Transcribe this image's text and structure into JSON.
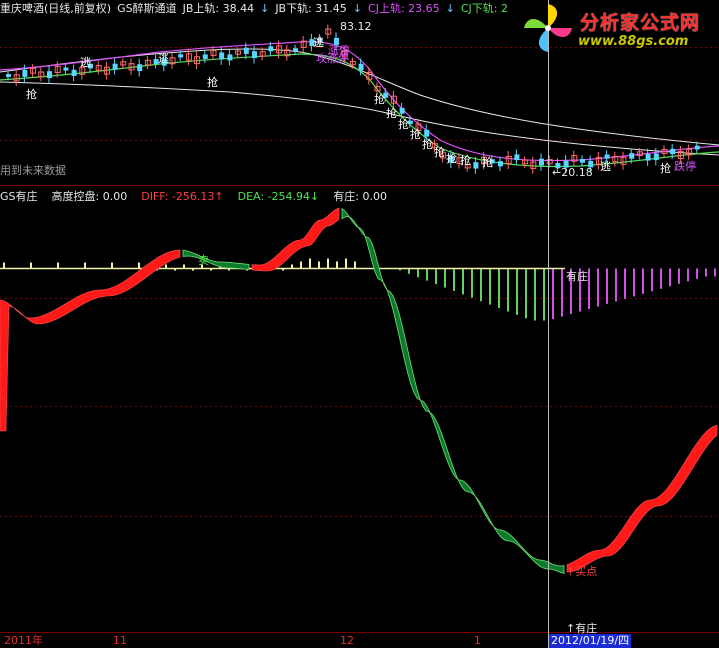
{
  "main_panel": {
    "title_items": [
      {
        "text": "重庆啤酒(日线,前复权)",
        "color": "white"
      },
      {
        "text": "GS醉斯通道",
        "color": "white"
      },
      {
        "text": "JB上轨: 38.44",
        "color": "white"
      },
      {
        "text": "↓",
        "color": "cyan"
      },
      {
        "text": "JB下轨: 31.45",
        "color": "white"
      },
      {
        "text": "↓",
        "color": "cyan"
      },
      {
        "text": "CJ上轨: 23.65",
        "color": "magenta"
      },
      {
        "text": "↓",
        "color": "cyan"
      },
      {
        "text": "CJ下轨: 2",
        "color": "green"
      }
    ],
    "high_label": "83.12",
    "low_label": "←20.18",
    "future_data_label": "用到未来数据",
    "signals_grab": [
      "抢",
      "抢",
      "抢",
      "抢",
      "抢",
      "抢",
      "抢",
      "抢",
      "抢",
      "抢",
      "抢",
      "抢"
    ],
    "signals_escape": [
      "逃",
      "逃",
      "逃",
      "逃"
    ],
    "signals_limit": [
      "攻涨停",
      "涨停",
      "跌停"
    ]
  },
  "sub_panel": {
    "title_items": [
      {
        "text": "GS有庄",
        "color": "white"
      },
      {
        "text": "高度控盘: 0.00",
        "color": "white"
      },
      {
        "text": "DIFF: -256.13↑",
        "color": "red"
      },
      {
        "text": "DEA: -254.94↓",
        "color": "green"
      },
      {
        "text": "有庄: 0.00",
        "color": "white"
      }
    ],
    "zero_line_label": "有庄",
    "buy_label": "↑买点",
    "bottom_label": "↑有庄",
    "sell_mark": "卖"
  },
  "axis": {
    "labels": [
      "2011年",
      "11",
      "12",
      "1"
    ],
    "cursor_date": "2012/01/19/四"
  },
  "logo": {
    "title": "分析家公式网",
    "url": "www.88gs.com"
  },
  "colors": {
    "background": "#000000",
    "grid": "#7a0000",
    "cursor": "#bdbdbd",
    "diff_red": "#ff1a1a",
    "dea_green": "#0e7a2e",
    "hist_pos": "#f2f2a8",
    "hist_neg_green": "#5fd35f",
    "hist_neg_magenta": "#d050e8"
  }
}
